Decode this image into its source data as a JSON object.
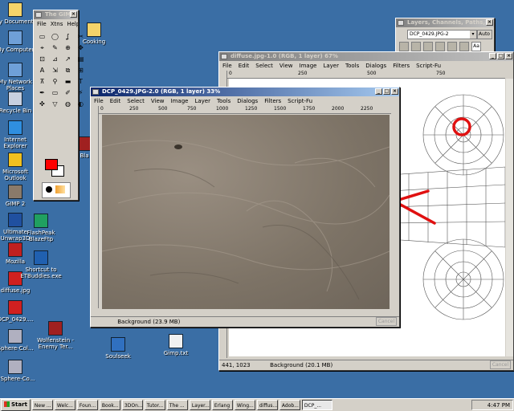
{
  "desktop": {
    "icons": [
      {
        "label": "My Documents",
        "color": "#f4d36a"
      },
      {
        "label": "My Computer",
        "color": "#6fa0d8"
      },
      {
        "label": "My Network Places",
        "color": "#6fa0d8"
      },
      {
        "label": "Recycle Bin",
        "color": "#c8d0e0"
      },
      {
        "label": "Internet Explorer",
        "color": "#2f8fe0"
      },
      {
        "label": "Microsoft Outlook",
        "color": "#f0c020"
      },
      {
        "label": "GIMP 2",
        "color": "#8a7a6a"
      },
      {
        "label": "Ultimate Unwrap3D",
        "color": "#2050a0"
      },
      {
        "label": "Mozilla",
        "color": "#c02020"
      },
      {
        "label": "diffuse.jpg",
        "color": "#d02020"
      },
      {
        "label": "DCP_0429....",
        "color": "#d02020"
      },
      {
        "label": "Sphere-Col...",
        "color": "#b0b0c0"
      },
      {
        "label": "#Sphere-Co...",
        "color": "#b0b0c0"
      },
      {
        "label": "Cooking",
        "color": "#f4d36a"
      },
      {
        "label": "FlashPeak BlazeFtp",
        "color": "#20a060"
      },
      {
        "label": "Shortcut to ETBuddies.exe",
        "color": "#2060b0"
      },
      {
        "label": "Wolfenstein - Enemy Ter...",
        "color": "#a02020"
      },
      {
        "label": "Soulseek",
        "color": "#3070c0"
      },
      {
        "label": "Gimp.txt",
        "color": "#f0f0f0"
      },
      {
        "label": "Bla",
        "color": "#a02020"
      }
    ]
  },
  "toolbox": {
    "title": "The GIMP",
    "menu": [
      "File",
      "Xtns",
      "Help"
    ],
    "tools": [
      "▭",
      "◯",
      "ʆ",
      "✂",
      "⌖",
      "✎",
      "⊕",
      "✥",
      "⊡",
      "⊿",
      "↗",
      "▤",
      "A",
      "⇲",
      "⧉",
      "⊞",
      "⊼",
      "⚲",
      "▬",
      "T",
      "✒",
      "▭",
      "✐",
      "⚡",
      "✜",
      "▽",
      "◍",
      "◐"
    ]
  },
  "layers_dialog": {
    "title": "Layers, Channels, Paths, Undo",
    "image_select": "DCP_0429.JPG-2",
    "auto_label": "Auto"
  },
  "diffuse_window": {
    "title": "diffuse.jpg-1.0 (RGB, 1 layer) 67%",
    "menu": [
      "File",
      "Edit",
      "Select",
      "View",
      "Image",
      "Layer",
      "Tools",
      "Dialogs",
      "Filters",
      "Script-Fu"
    ],
    "ruler_labels": [
      "0",
      "250",
      "500",
      "750"
    ],
    "status_coords": "441, 1023",
    "status_text": "Background (20.1 MB)",
    "cancel_label": "Cancel"
  },
  "photo_window": {
    "title": "DCP_0429.JPG-2.0 (RGB, 1 layer) 33%",
    "menu": [
      "File",
      "Edit",
      "Select",
      "View",
      "Image",
      "Layer",
      "Tools",
      "Dialogs",
      "Filters",
      "Script-Fu"
    ],
    "ruler_labels": [
      "0",
      "250",
      "500",
      "750",
      "1000",
      "1250",
      "1500",
      "1750",
      "2000",
      "2250"
    ],
    "status_text": "Background (23.9 MB)",
    "cancel_label": "Cancel"
  },
  "taskbar": {
    "start_label": "Start",
    "tasks": [
      "New ...",
      "Welc...",
      "Foun...",
      "Book...",
      "3DOn...",
      "Tutor...",
      "The ...",
      "Layer...",
      "Erlang",
      "Wing...",
      "diffus...",
      "Adob...",
      "DCP_..."
    ],
    "clock": "4:47 PM"
  }
}
